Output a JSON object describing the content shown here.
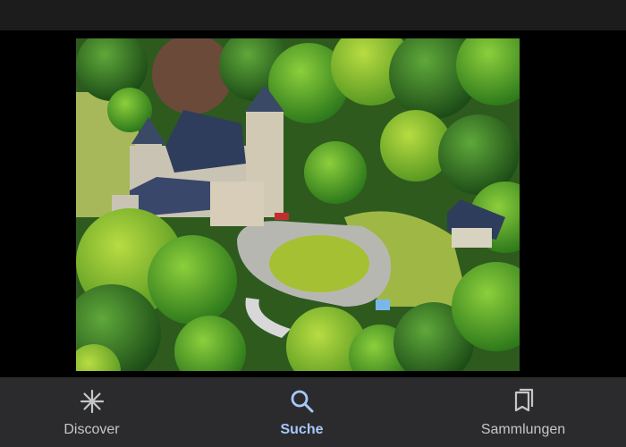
{
  "image": {
    "subject": "aerial-photo-castle"
  },
  "bottom_nav": {
    "items": [
      {
        "label": "Discover",
        "icon": "asterisk-icon",
        "active": false
      },
      {
        "label": "Suche",
        "icon": "search-icon",
        "active": true
      },
      {
        "label": "Sammlungen",
        "icon": "bookmarks-icon",
        "active": false
      }
    ]
  },
  "colors": {
    "nav_background": "#2b2b2d",
    "active_accent": "#a8c7fa",
    "inactive_text": "#c4c7c5"
  }
}
